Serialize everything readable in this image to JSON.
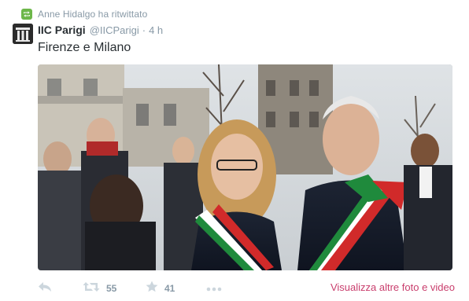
{
  "retweet_context": {
    "text": "Anne Hidalgo ha ritwittato",
    "icon": "retweet-icon"
  },
  "tweet": {
    "fullname": "IIC Parigi",
    "username": "@IICParigi",
    "separator": "·",
    "time": "4 h",
    "text": "Firenze e Milano"
  },
  "actions": {
    "reply_icon": "reply-icon",
    "retweet_icon": "retweet-icon",
    "retweet_count": "55",
    "favorite_icon": "star-icon",
    "favorite_count": "41",
    "more_icon": "more-icon",
    "more_media_label": "Visualizza altre foto e video"
  },
  "colors": {
    "retweet_green": "#6db74a",
    "link_pink": "#c93e6d",
    "meta_gray": "#8899a6",
    "text_dark": "#292f33"
  }
}
